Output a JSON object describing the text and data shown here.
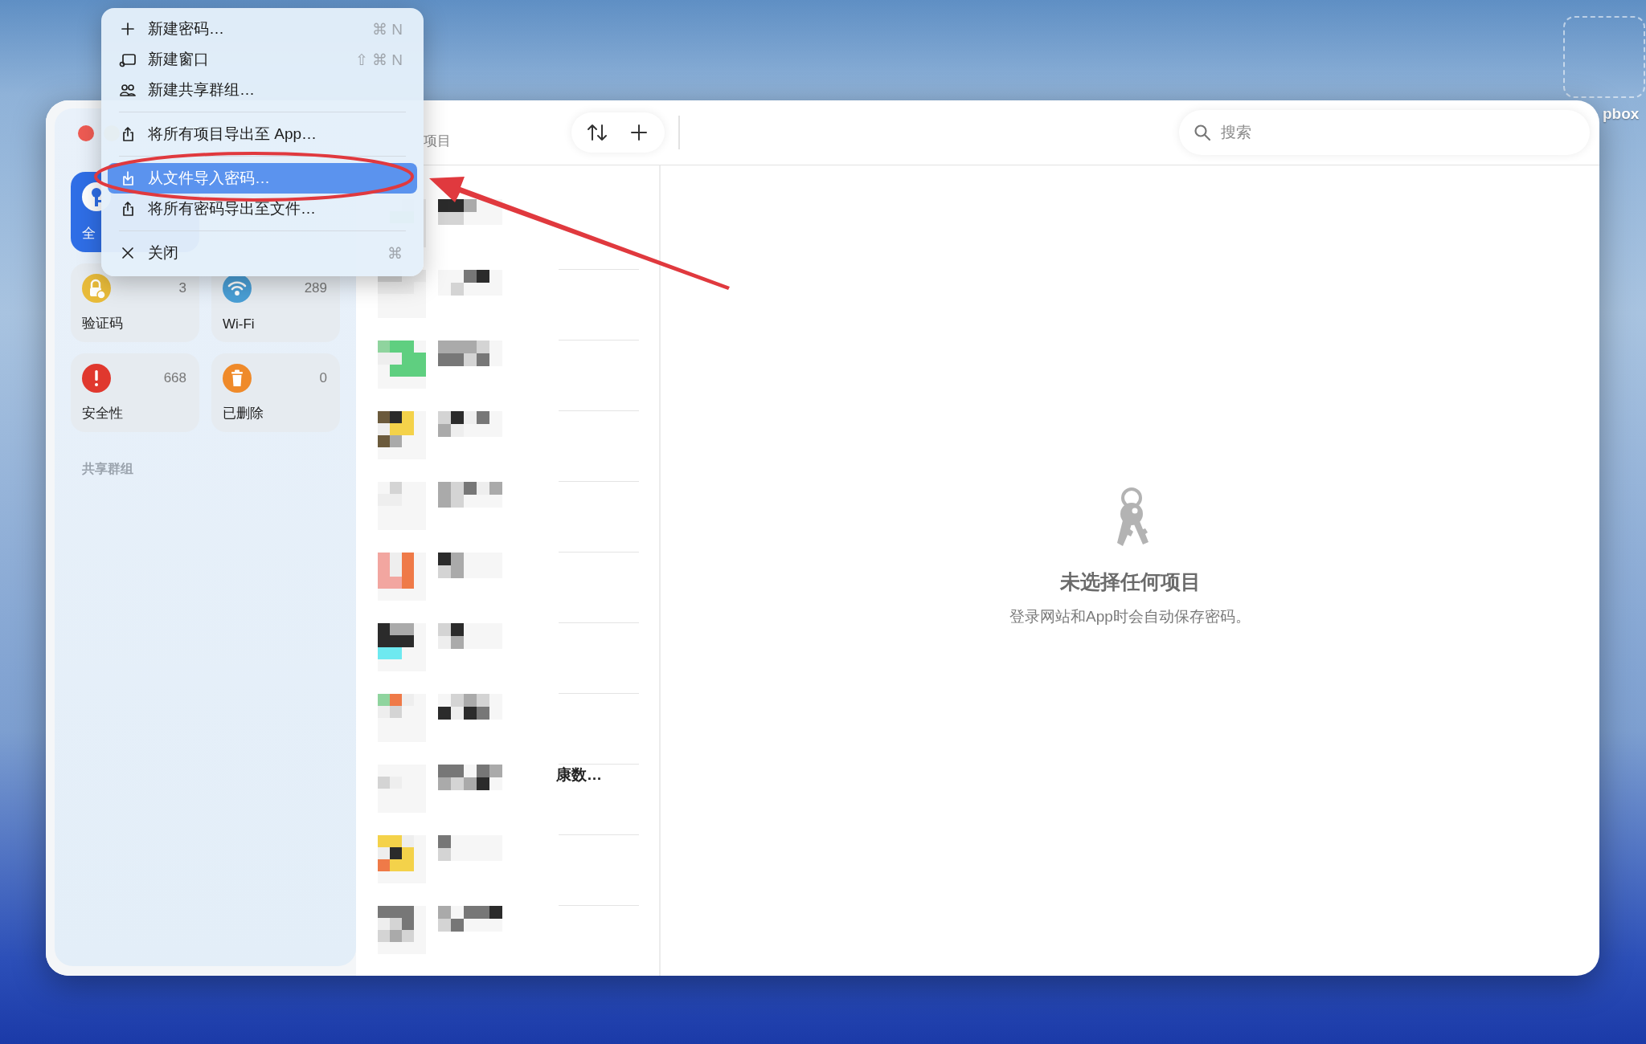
{
  "desktop": {
    "icon_label": "pbox"
  },
  "window": {
    "toolbar_title": "项目",
    "search": {
      "placeholder": "搜索"
    }
  },
  "sidebar": {
    "tiles": [
      {
        "label": "全",
        "selected": true,
        "color": "#ffffff"
      },
      {
        "label": "验证码",
        "count": "3",
        "selected": false,
        "color": "#e8bb3a"
      },
      {
        "label": "Wi-Fi",
        "count": "289",
        "selected": false,
        "color": "#4a9fd6"
      },
      {
        "label": "安全性",
        "count": "668",
        "selected": false,
        "color": "#e0382e"
      },
      {
        "label": "已删除",
        "count": "0",
        "selected": false,
        "color": "#ef8a2a"
      }
    ],
    "section_header": "共享群组"
  },
  "list": {
    "fragment": "康数…"
  },
  "detail": {
    "title": "未选择任何项目",
    "subtitle": "登录网站和App时会自动保存密码。"
  },
  "menu": {
    "groups": [
      [
        {
          "label": "新建密码…",
          "shortcut": "⌘ N",
          "selected": false
        },
        {
          "label": "新建窗口",
          "shortcut": "⇧ ⌘ N",
          "selected": false
        },
        {
          "label": "新建共享群组…",
          "selected": false
        }
      ],
      [
        {
          "label": "将所有项目导出至 App…",
          "selected": false
        }
      ],
      [
        {
          "label": "从文件导入密码…",
          "selected": true
        },
        {
          "label": "将所有密码导出至文件…",
          "selected": false
        }
      ],
      [
        {
          "label": "关闭",
          "shortcut": "⌘",
          "selected": false
        }
      ]
    ]
  }
}
